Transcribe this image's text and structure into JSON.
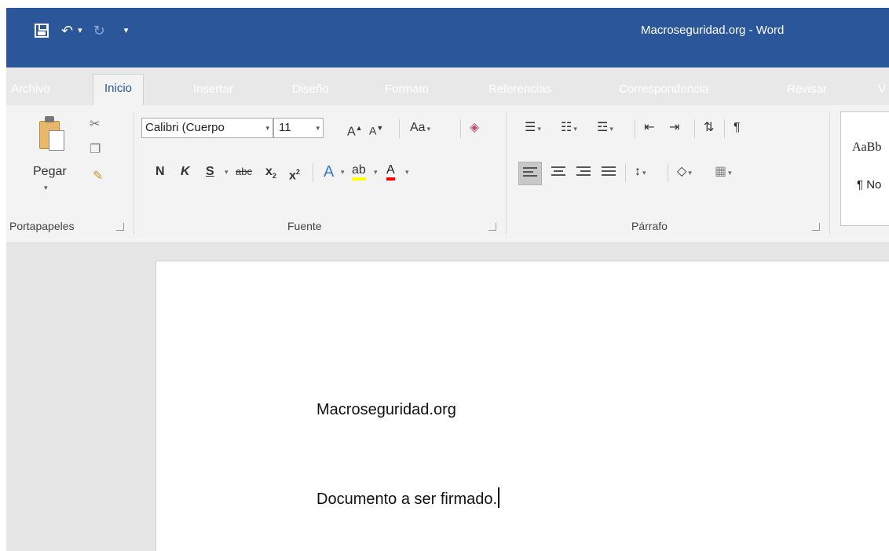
{
  "window": {
    "title": "Macroseguridad.org  -  Word"
  },
  "qat": {
    "save_icon": "save-icon",
    "undo_icon": "undo-icon",
    "redo_icon": "redo-icon",
    "customize_icon": "customize-qat-icon"
  },
  "tabs": [
    {
      "label": "Archivo"
    },
    {
      "label": "Inicio",
      "active": true
    },
    {
      "label": "Insertar"
    },
    {
      "label": "Diseño"
    },
    {
      "label": "Formato"
    },
    {
      "label": "Referencias"
    },
    {
      "label": "Correspondencia"
    },
    {
      "label": "Revisar"
    },
    {
      "label": "V"
    }
  ],
  "ribbon": {
    "clipboard": {
      "paste_label": "Pegar",
      "group_label": "Portapapeles"
    },
    "font": {
      "font_name": "Calibri (Cuerpo",
      "font_size": "11",
      "grow_label": "A",
      "shrink_label": "A",
      "case_label": "Aa",
      "bold_label": "N",
      "italic_label": "K",
      "underline_label": "S",
      "strike_label": "abc",
      "sub_label": "x",
      "sup_label": "x",
      "effects_label": "A",
      "highlight_label": "ab",
      "color_label": "A",
      "group_label": "Fuente",
      "highlight_color": "#ffff00",
      "font_color": "#ff0000"
    },
    "paragraph": {
      "group_label": "Párrafo"
    },
    "styles": {
      "sample": "AaBb",
      "name": "¶ No"
    }
  },
  "document": {
    "lines": [
      {
        "text": "Macroseguridad.org"
      },
      {
        "text": "Documento a ser firmado."
      }
    ]
  },
  "colors": {
    "accent": "#2b579a",
    "ribbon_bg": "#f3f3f3",
    "doc_bg": "#e6e6e6"
  }
}
